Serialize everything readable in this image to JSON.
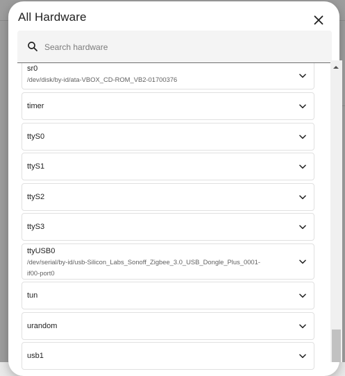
{
  "dialog": {
    "title": "All Hardware",
    "search_placeholder": "Search hardware"
  },
  "hardware": [
    {
      "name": "sr0",
      "path": "/dev/disk/by-id/ata-VBOX_CD-ROM_VB2-01700376"
    },
    {
      "name": "timer",
      "path": ""
    },
    {
      "name": "ttyS0",
      "path": ""
    },
    {
      "name": "ttyS1",
      "path": ""
    },
    {
      "name": "ttyS2",
      "path": ""
    },
    {
      "name": "ttyS3",
      "path": ""
    },
    {
      "name": "ttyUSB0",
      "path": "/dev/serial/by-id/usb-Silicon_Labs_Sonoff_Zigbee_3.0_USB_Dongle_Plus_0001-\nif00-port0"
    },
    {
      "name": "tun",
      "path": ""
    },
    {
      "name": "urandom",
      "path": ""
    },
    {
      "name": "usb1",
      "path": ""
    }
  ],
  "icons": {
    "close": "close-icon",
    "search": "search-icon",
    "expand": "chevron-down-icon"
  }
}
